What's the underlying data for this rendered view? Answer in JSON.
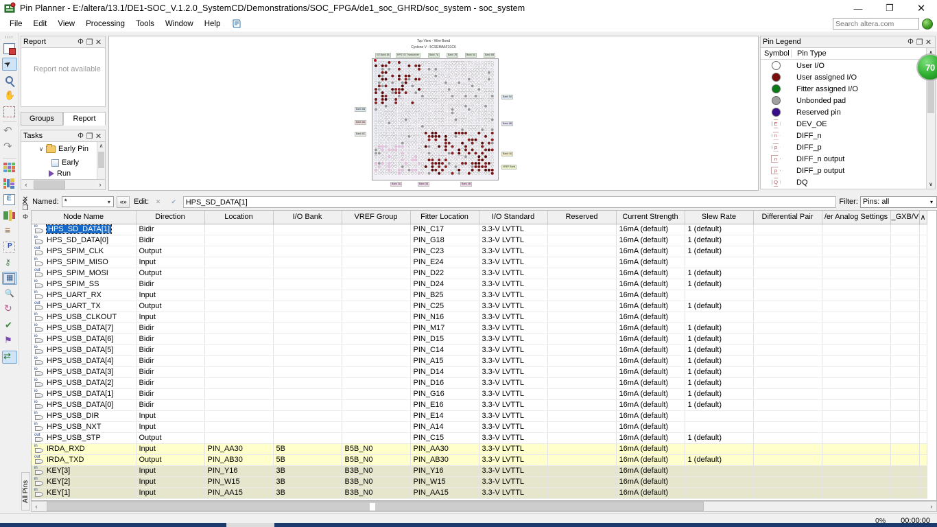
{
  "window": {
    "title": "Pin Planner - E:/altera/13.1/DE1-SOC_V.1.2.0_SystemCD/Demonstrations/SOC_FPGA/de1_soc_GHRD/soc_system - soc_system",
    "app_icon": "pin-planner-icon",
    "minimize": "—",
    "maximize": "❐",
    "close": "✕"
  },
  "menu": {
    "items": [
      "File",
      "Edit",
      "View",
      "Processing",
      "Tools",
      "Window",
      "Help"
    ],
    "extra_icon": "notes-icon"
  },
  "search": {
    "placeholder": "Search altera.com",
    "value": "",
    "globe_icon": "globe-icon"
  },
  "left_toolbar": {
    "tools": [
      {
        "name": "new-report-icon",
        "selected": false
      },
      {
        "name": "select-arrow-icon",
        "selected": true
      },
      {
        "name": "zoom-icon",
        "selected": false
      },
      {
        "name": "pan-hand-icon",
        "selected": false
      },
      {
        "name": "fit-in-window-icon",
        "selected": false
      },
      {
        "name": "undo-icon",
        "selected": false
      },
      {
        "name": "redo-icon",
        "selected": false
      },
      {
        "name": "package-grid-icon",
        "selected": false
      },
      {
        "name": "pad-view-icon",
        "selected": false
      },
      {
        "name": "report-window-icon",
        "selected": false
      },
      {
        "name": "package-top-icon",
        "selected": false
      },
      {
        "name": "pin-list-icon",
        "selected": false
      },
      {
        "name": "pin-properties-icon",
        "selected": false
      },
      {
        "name": "io-bank-icon",
        "selected": false
      },
      {
        "name": "vref-group-icon",
        "selected": true
      },
      {
        "name": "find-pin-icon",
        "selected": false
      },
      {
        "name": "refresh-icon",
        "selected": false
      },
      {
        "name": "validate-check-icon",
        "selected": false
      },
      {
        "name": "flag-io-icon",
        "selected": false
      },
      {
        "name": "swap-pins-icon",
        "selected": true
      }
    ]
  },
  "report_panel": {
    "title": "Report",
    "message": "Report not available",
    "pin_icon": "Φ",
    "float_icon": "❐",
    "close_icon": "✕"
  },
  "bottom_tabs": {
    "items": [
      {
        "label": "Groups",
        "active": false
      },
      {
        "label": "Report",
        "active": true
      }
    ]
  },
  "tasks_panel": {
    "title": "Tasks",
    "pin_icon": "Φ",
    "float_icon": "❐",
    "close_icon": "✕",
    "rows": [
      {
        "chevron": "∨",
        "icon": "folder-icon",
        "label": "Early Pin"
      },
      {
        "chevron": "",
        "icon": "square-icon",
        "label": "Early"
      },
      {
        "chevron": "",
        "icon": "play-icon",
        "label": "Run"
      }
    ],
    "scroll_up": "∧",
    "scroll_down": "∨",
    "h_left": "‹",
    "h_right": "›"
  },
  "chip_view": {
    "title_line1": "Top View - Wire Bond",
    "title_line2": "Cyclone V - 5CSEMA5F31C6",
    "bands_top": [
      "I/O Bank 8A",
      "HPS I/O Transceiver",
      "Bank 7A",
      "Bank 7B",
      "Bank 6A",
      "Bank 6B"
    ],
    "bands_left": [
      "Bank 8B",
      "Bank 8A",
      "Bank 8C"
    ],
    "bands_right": [
      "Bank 5A",
      "Bank 5B",
      "Bank 4A",
      "VREF Bank"
    ],
    "bands_bottom": [
      "Bank 3A",
      "Bank 3B",
      "Bank 4B"
    ]
  },
  "pin_legend": {
    "title": "Pin Legend",
    "pin_icon": "Φ",
    "float_icon": "❐",
    "close_icon": "✕",
    "col_symbol": "Symbol",
    "col_pin_type": "Pin Type",
    "entries": [
      {
        "symbol_kind": "circle",
        "glyph": "",
        "color": "#ffffff",
        "label": "User I/O"
      },
      {
        "symbol_kind": "circle",
        "glyph": "",
        "color": "#7a0e0e",
        "label": "User assigned I/O"
      },
      {
        "symbol_kind": "circle",
        "glyph": "",
        "color": "#0a7a16",
        "label": "Fitter assigned I/O"
      },
      {
        "symbol_kind": "circle",
        "glyph": "",
        "color": "#a0a0a0",
        "label": "Unbonded pad"
      },
      {
        "symbol_kind": "circle",
        "glyph": "",
        "color": "#3a0d8a",
        "label": "Reserved pin"
      },
      {
        "symbol_kind": "octagon",
        "glyph": "E",
        "color": "#ffffff",
        "label": "DEV_OE"
      },
      {
        "symbol_kind": "hexagon",
        "glyph": "n",
        "color": "#ffffff",
        "label": "DIFF_n"
      },
      {
        "symbol_kind": "hexagon",
        "glyph": "p",
        "color": "#ffffff",
        "label": "DIFF_p"
      },
      {
        "symbol_kind": "tag",
        "glyph": "n",
        "color": "#ffffff",
        "label": "DIFF_n output"
      },
      {
        "symbol_kind": "tag",
        "glyph": "p",
        "color": "#ffffff",
        "label": "DIFF_p output"
      },
      {
        "symbol_kind": "octagon",
        "glyph": "Q",
        "color": "#ffffff",
        "label": "DQ"
      }
    ],
    "scroll_up": "∧",
    "scroll_down": "∨",
    "badge_value": "70"
  },
  "filter_bar": {
    "close_icon": "✕",
    "named_label": "Named:",
    "named_value": "*",
    "wildcard_icon": "«»",
    "edit_label": "Edit:",
    "cancel_icon": "✕",
    "accept_icon": "✔",
    "edit_value": "HPS_SD_DATA[1]",
    "filter_label": "Filter:",
    "filter_value": "Pins: all",
    "chevron": "▾"
  },
  "dock_strip": {
    "close_icon": "✕",
    "float_icon": "❐",
    "pin_icon": "Φ",
    "vertical_tab": "All Pins"
  },
  "table": {
    "columns": [
      "Node Name",
      "Direction",
      "Location",
      "I/O Bank",
      "VREF Group",
      "Fitter Location",
      "I/O Standard",
      "Reserved",
      "Current Strength",
      "Slew Rate",
      "Differential Pair",
      "/er Analog Settings",
      "_GXB/VCC"
    ],
    "scroll_arrow": "∧",
    "rows": [
      {
        "icon": "io",
        "node": "HPS_SD_DATA[1]",
        "dir": "Bidir",
        "loc": "",
        "bank": "",
        "vref": "",
        "fitter": "PIN_C17",
        "std": "3.3-V LVTTL",
        "res": "",
        "cur": "16mA (default)",
        "slew": "1 (default)",
        "diff": "",
        "analog": "",
        "gxb": "",
        "selected": true,
        "hl": ""
      },
      {
        "icon": "io",
        "node": "HPS_SD_DATA[0]",
        "dir": "Bidir",
        "loc": "",
        "bank": "",
        "vref": "",
        "fitter": "PIN_G18",
        "std": "3.3-V LVTTL",
        "res": "",
        "cur": "16mA (default)",
        "slew": "1 (default)",
        "diff": "",
        "analog": "",
        "gxb": "",
        "selected": false,
        "hl": ""
      },
      {
        "icon": "out",
        "node": "HPS_SPIM_CLK",
        "dir": "Output",
        "loc": "",
        "bank": "",
        "vref": "",
        "fitter": "PIN_C23",
        "std": "3.3-V LVTTL",
        "res": "",
        "cur": "16mA (default)",
        "slew": "1 (default)",
        "diff": "",
        "analog": "",
        "gxb": "",
        "selected": false,
        "hl": ""
      },
      {
        "icon": "in",
        "node": "HPS_SPIM_MISO",
        "dir": "Input",
        "loc": "",
        "bank": "",
        "vref": "",
        "fitter": "PIN_E24",
        "std": "3.3-V LVTTL",
        "res": "",
        "cur": "16mA (default)",
        "slew": "",
        "diff": "",
        "analog": "",
        "gxb": "",
        "selected": false,
        "hl": ""
      },
      {
        "icon": "out",
        "node": "HPS_SPIM_MOSI",
        "dir": "Output",
        "loc": "",
        "bank": "",
        "vref": "",
        "fitter": "PIN_D22",
        "std": "3.3-V LVTTL",
        "res": "",
        "cur": "16mA (default)",
        "slew": "1 (default)",
        "diff": "",
        "analog": "",
        "gxb": "",
        "selected": false,
        "hl": ""
      },
      {
        "icon": "io",
        "node": "HPS_SPIM_SS",
        "dir": "Bidir",
        "loc": "",
        "bank": "",
        "vref": "",
        "fitter": "PIN_D24",
        "std": "3.3-V LVTTL",
        "res": "",
        "cur": "16mA (default)",
        "slew": "1 (default)",
        "diff": "",
        "analog": "",
        "gxb": "",
        "selected": false,
        "hl": ""
      },
      {
        "icon": "in",
        "node": "HPS_UART_RX",
        "dir": "Input",
        "loc": "",
        "bank": "",
        "vref": "",
        "fitter": "PIN_B25",
        "std": "3.3-V LVTTL",
        "res": "",
        "cur": "16mA (default)",
        "slew": "",
        "diff": "",
        "analog": "",
        "gxb": "",
        "selected": false,
        "hl": ""
      },
      {
        "icon": "out",
        "node": "HPS_UART_TX",
        "dir": "Output",
        "loc": "",
        "bank": "",
        "vref": "",
        "fitter": "PIN_C25",
        "std": "3.3-V LVTTL",
        "res": "",
        "cur": "16mA (default)",
        "slew": "1 (default)",
        "diff": "",
        "analog": "",
        "gxb": "",
        "selected": false,
        "hl": ""
      },
      {
        "icon": "in",
        "node": "HPS_USB_CLKOUT",
        "dir": "Input",
        "loc": "",
        "bank": "",
        "vref": "",
        "fitter": "PIN_N16",
        "std": "3.3-V LVTTL",
        "res": "",
        "cur": "16mA (default)",
        "slew": "",
        "diff": "",
        "analog": "",
        "gxb": "",
        "selected": false,
        "hl": ""
      },
      {
        "icon": "io",
        "node": "HPS_USB_DATA[7]",
        "dir": "Bidir",
        "loc": "",
        "bank": "",
        "vref": "",
        "fitter": "PIN_M17",
        "std": "3.3-V LVTTL",
        "res": "",
        "cur": "16mA (default)",
        "slew": "1 (default)",
        "diff": "",
        "analog": "",
        "gxb": "",
        "selected": false,
        "hl": ""
      },
      {
        "icon": "io",
        "node": "HPS_USB_DATA[6]",
        "dir": "Bidir",
        "loc": "",
        "bank": "",
        "vref": "",
        "fitter": "PIN_D15",
        "std": "3.3-V LVTTL",
        "res": "",
        "cur": "16mA (default)",
        "slew": "1 (default)",
        "diff": "",
        "analog": "",
        "gxb": "",
        "selected": false,
        "hl": ""
      },
      {
        "icon": "io",
        "node": "HPS_USB_DATA[5]",
        "dir": "Bidir",
        "loc": "",
        "bank": "",
        "vref": "",
        "fitter": "PIN_C14",
        "std": "3.3-V LVTTL",
        "res": "",
        "cur": "16mA (default)",
        "slew": "1 (default)",
        "diff": "",
        "analog": "",
        "gxb": "",
        "selected": false,
        "hl": ""
      },
      {
        "icon": "io",
        "node": "HPS_USB_DATA[4]",
        "dir": "Bidir",
        "loc": "",
        "bank": "",
        "vref": "",
        "fitter": "PIN_A15",
        "std": "3.3-V LVTTL",
        "res": "",
        "cur": "16mA (default)",
        "slew": "1 (default)",
        "diff": "",
        "analog": "",
        "gxb": "",
        "selected": false,
        "hl": ""
      },
      {
        "icon": "io",
        "node": "HPS_USB_DATA[3]",
        "dir": "Bidir",
        "loc": "",
        "bank": "",
        "vref": "",
        "fitter": "PIN_D14",
        "std": "3.3-V LVTTL",
        "res": "",
        "cur": "16mA (default)",
        "slew": "1 (default)",
        "diff": "",
        "analog": "",
        "gxb": "",
        "selected": false,
        "hl": ""
      },
      {
        "icon": "io",
        "node": "HPS_USB_DATA[2]",
        "dir": "Bidir",
        "loc": "",
        "bank": "",
        "vref": "",
        "fitter": "PIN_D16",
        "std": "3.3-V LVTTL",
        "res": "",
        "cur": "16mA (default)",
        "slew": "1 (default)",
        "diff": "",
        "analog": "",
        "gxb": "",
        "selected": false,
        "hl": ""
      },
      {
        "icon": "io",
        "node": "HPS_USB_DATA[1]",
        "dir": "Bidir",
        "loc": "",
        "bank": "",
        "vref": "",
        "fitter": "PIN_G16",
        "std": "3.3-V LVTTL",
        "res": "",
        "cur": "16mA (default)",
        "slew": "1 (default)",
        "diff": "",
        "analog": "",
        "gxb": "",
        "selected": false,
        "hl": ""
      },
      {
        "icon": "io",
        "node": "HPS_USB_DATA[0]",
        "dir": "Bidir",
        "loc": "",
        "bank": "",
        "vref": "",
        "fitter": "PIN_E16",
        "std": "3.3-V LVTTL",
        "res": "",
        "cur": "16mA (default)",
        "slew": "1 (default)",
        "diff": "",
        "analog": "",
        "gxb": "",
        "selected": false,
        "hl": ""
      },
      {
        "icon": "in",
        "node": "HPS_USB_DIR",
        "dir": "Input",
        "loc": "",
        "bank": "",
        "vref": "",
        "fitter": "PIN_E14",
        "std": "3.3-V LVTTL",
        "res": "",
        "cur": "16mA (default)",
        "slew": "",
        "diff": "",
        "analog": "",
        "gxb": "",
        "selected": false,
        "hl": ""
      },
      {
        "icon": "in",
        "node": "HPS_USB_NXT",
        "dir": "Input",
        "loc": "",
        "bank": "",
        "vref": "",
        "fitter": "PIN_A14",
        "std": "3.3-V LVTTL",
        "res": "",
        "cur": "16mA (default)",
        "slew": "",
        "diff": "",
        "analog": "",
        "gxb": "",
        "selected": false,
        "hl": ""
      },
      {
        "icon": "out",
        "node": "HPS_USB_STP",
        "dir": "Output",
        "loc": "",
        "bank": "",
        "vref": "",
        "fitter": "PIN_C15",
        "std": "3.3-V LVTTL",
        "res": "",
        "cur": "16mA (default)",
        "slew": "1 (default)",
        "diff": "",
        "analog": "",
        "gxb": "",
        "selected": false,
        "hl": ""
      },
      {
        "icon": "in",
        "node": "IRDA_RXD",
        "dir": "Input",
        "loc": "PIN_AA30",
        "bank": "5B",
        "vref": "B5B_N0",
        "fitter": "PIN_AA30",
        "std": "3.3-V LVTTL",
        "res": "",
        "cur": "16mA (default)",
        "slew": "",
        "diff": "",
        "analog": "",
        "gxb": "",
        "selected": false,
        "hl": "yellow"
      },
      {
        "icon": "out",
        "node": "IRDA_TXD",
        "dir": "Output",
        "loc": "PIN_AB30",
        "bank": "5B",
        "vref": "B5B_N0",
        "fitter": "PIN_AB30",
        "std": "3.3-V LVTTL",
        "res": "",
        "cur": "16mA (default)",
        "slew": "1 (default)",
        "diff": "",
        "analog": "",
        "gxb": "",
        "selected": false,
        "hl": "yellow"
      },
      {
        "icon": "in",
        "node": "KEY[3]",
        "dir": "Input",
        "loc": "PIN_Y16",
        "bank": "3B",
        "vref": "B3B_N0",
        "fitter": "PIN_Y16",
        "std": "3.3-V LVTTL",
        "res": "",
        "cur": "16mA (default)",
        "slew": "",
        "diff": "",
        "analog": "",
        "gxb": "",
        "selected": false,
        "hl": "olive"
      },
      {
        "icon": "in",
        "node": "KEY[2]",
        "dir": "Input",
        "loc": "PIN_W15",
        "bank": "3B",
        "vref": "B3B_N0",
        "fitter": "PIN_W15",
        "std": "3.3-V LVTTL",
        "res": "",
        "cur": "16mA (default)",
        "slew": "",
        "diff": "",
        "analog": "",
        "gxb": "",
        "selected": false,
        "hl": "olive"
      },
      {
        "icon": "in",
        "node": "KEY[1]",
        "dir": "Input",
        "loc": "PIN_AA15",
        "bank": "3B",
        "vref": "B3B_N0",
        "fitter": "PIN_AA15",
        "std": "3.3-V LVTTL",
        "res": "",
        "cur": "16mA (default)",
        "slew": "",
        "diff": "",
        "analog": "",
        "gxb": "",
        "selected": false,
        "hl": "olive"
      }
    ]
  },
  "table_hscroll": {
    "left_arrow": "‹",
    "right_arrow": "›"
  },
  "status_bar": {
    "percent": "0%",
    "time": "00:00:00"
  }
}
